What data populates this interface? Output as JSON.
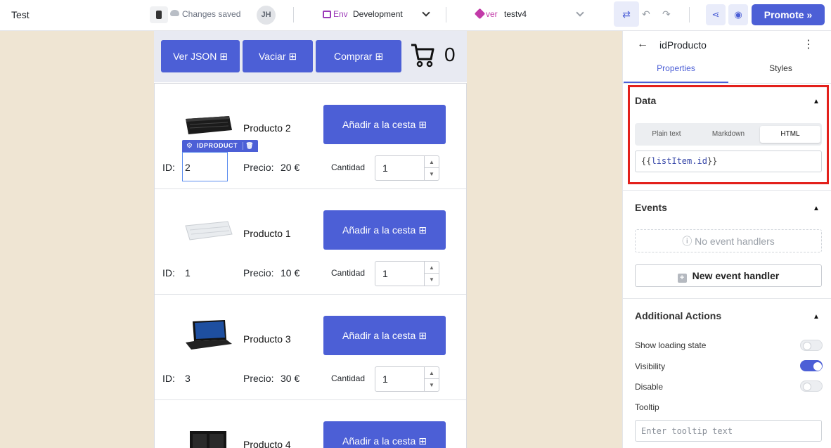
{
  "header": {
    "app_title": "Test",
    "save_status": "Changes saved",
    "avatar_initials": "JH",
    "env_label": "Env",
    "env_value": "Development",
    "version_label": "ver",
    "version_value": "testv4",
    "promote_label": "Promote",
    "promote_icon": "chevrons-right-icon"
  },
  "canvas": {
    "top_buttons": [
      {
        "label": "Ver JSON",
        "icon": "cart-icon"
      },
      {
        "label": "Vaciar",
        "icon": "cart-remove-icon"
      },
      {
        "label": "Comprar",
        "icon": "cart-check-icon"
      }
    ],
    "cart_count": "0",
    "products": [
      {
        "name": "Producto 2",
        "id": "2",
        "price": "20 €",
        "image": "keyboard-black",
        "add_label": "Añadir a la cesta",
        "id_label": "ID:",
        "price_label": "Precio:",
        "qty_label": "Cantidad",
        "qty": "1"
      },
      {
        "name": "Producto 1",
        "id": "1",
        "price": "10 €",
        "image": "keyboard-white",
        "add_label": "Añadir a la cesta",
        "id_label": "ID:",
        "price_label": "Precio:",
        "qty_label": "Cantidad",
        "qty": "1"
      },
      {
        "name": "Producto 3",
        "id": "3",
        "price": "30 €",
        "image": "laptop",
        "add_label": "Añadir a la cesta",
        "id_label": "ID:",
        "price_label": "Precio:",
        "qty_label": "Cantidad",
        "qty": "1"
      },
      {
        "name": "Producto 4",
        "id": "",
        "price": "",
        "image": "pc-tower",
        "add_label": "Añadir a la cesta",
        "id_label": "",
        "price_label": "",
        "qty_label": "",
        "qty": ""
      }
    ],
    "selection_tag": "IDPRODUCT"
  },
  "panel": {
    "component_name": "idProducto",
    "tabs": [
      "Properties",
      "Styles"
    ],
    "data_section": {
      "title": "Data",
      "modes": [
        "Plain text",
        "Markdown",
        "HTML"
      ],
      "active_mode": "HTML",
      "code_open": "{{",
      "code_expr": "listItem.id",
      "code_close": "}}"
    },
    "events_section": {
      "title": "Events",
      "empty_text": "No event handlers",
      "new_handler_label": "New event handler"
    },
    "actions_section": {
      "title": "Additional Actions",
      "options": [
        {
          "label": "Show loading state",
          "on": false
        },
        {
          "label": "Visibility",
          "on": true
        },
        {
          "label": "Disable",
          "on": false
        }
      ],
      "tooltip_label": "Tooltip",
      "tooltip_placeholder": "Enter tooltip text"
    }
  },
  "colors": {
    "accent": "#4c5fd6",
    "highlight": "#e3201b",
    "canvas_bg": "#efe5d3"
  }
}
